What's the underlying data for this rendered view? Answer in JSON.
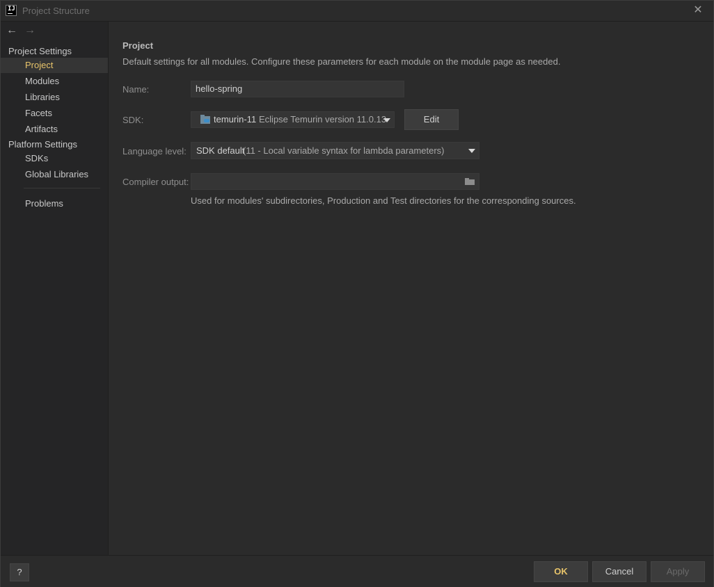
{
  "window": {
    "title": "Project Structure",
    "app_icon_text": "IJ"
  },
  "nav": {
    "back": "←",
    "forward": "→"
  },
  "sidebar": {
    "project_settings_header": "Project Settings",
    "project_settings_items": [
      {
        "label": "Project",
        "selected": true
      },
      {
        "label": "Modules"
      },
      {
        "label": "Libraries"
      },
      {
        "label": "Facets"
      },
      {
        "label": "Artifacts"
      }
    ],
    "platform_settings_header": "Platform Settings",
    "platform_settings_items": [
      {
        "label": "SDKs"
      },
      {
        "label": "Global Libraries"
      }
    ],
    "problems_label": "Problems"
  },
  "main": {
    "heading": "Project",
    "description": "Default settings for all modules. Configure these parameters for each module on the module page as needed.",
    "name_label": "Name:",
    "name_value": "hello-spring",
    "sdk_label": "SDK:",
    "sdk_name": "temurin-11",
    "sdk_version": "Eclipse Temurin version 11.0.13",
    "edit_button": "Edit",
    "language_level_label": "Language level:",
    "language_level_value": "SDK default",
    "language_level_detail": "(11 - Local variable syntax for lambda parameters)",
    "compiler_output_label": "Compiler output:",
    "compiler_output_value": "",
    "compiler_output_hint": "Used for modules' subdirectories, Production and Test directories for the corresponding sources."
  },
  "footer": {
    "help_label": "?",
    "ok_label": "OK",
    "cancel_label": "Cancel",
    "apply_label": "Apply"
  },
  "colors": {
    "background": "#2b2b2b",
    "sidebar_background": "#252526",
    "selected_item_text": "#e8c46a",
    "text": "#bbbbbb"
  }
}
